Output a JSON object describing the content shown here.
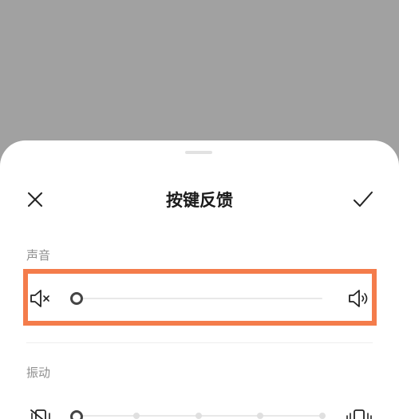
{
  "sheet": {
    "title": "按键反馈",
    "close_icon": "close-icon",
    "confirm_icon": "checkmark-icon"
  },
  "sound": {
    "label": "声音",
    "min_icon": "speaker-mute-icon",
    "max_icon": "speaker-volume-icon",
    "level_percent": 0
  },
  "vibration": {
    "label": "振动",
    "min_icon": "vibration-off-icon",
    "max_icon": "vibration-icon",
    "level_step": 0,
    "step_count": 5
  },
  "colors": {
    "highlight": "#f47c4b",
    "backdrop": "#a1a1a1"
  }
}
